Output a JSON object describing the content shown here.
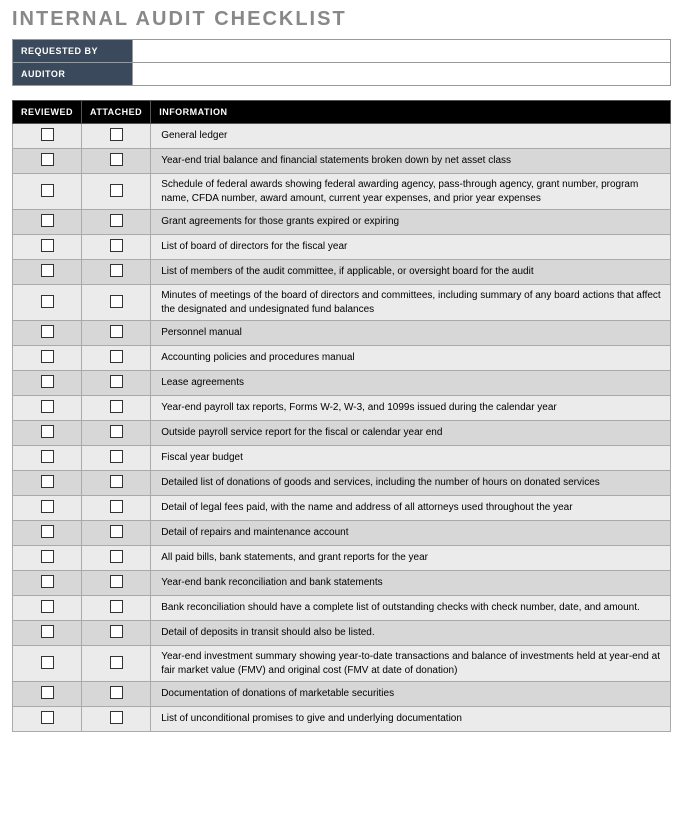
{
  "title": "INTERNAL AUDIT CHECKLIST",
  "header": {
    "requested_by_label": "REQUESTED BY",
    "requested_by_value": "",
    "auditor_label": "AUDITOR",
    "auditor_value": ""
  },
  "columns": {
    "reviewed": "REVIEWED",
    "attached": "ATTACHED",
    "information": "INFORMATION"
  },
  "items": [
    "General ledger",
    "Year-end trial balance and financial statements broken down by net asset class",
    "Schedule of federal awards showing federal awarding agency, pass-through agency, grant number, program name, CFDA number, award amount, current year expenses, and prior year expenses",
    "Grant agreements for those grants expired or expiring",
    "List of board of directors for the fiscal year",
    "List of members of the audit committee, if applicable, or oversight board for the audit",
    "Minutes of meetings of the board of directors and committees, including summary of any board actions that affect the designated and undesignated fund balances",
    "Personnel manual",
    "Accounting policies and procedures manual",
    "Lease agreements",
    "Year-end payroll tax reports, Forms W-2, W-3, and 1099s issued during the calendar year",
    "Outside payroll service report for the fiscal or calendar year end",
    "Fiscal year budget",
    "Detailed list of donations of goods and services, including the number of hours on donated services",
    "Detail of legal fees paid, with the name and address of all attorneys used throughout the year",
    "Detail of repairs and maintenance account",
    "All paid bills, bank statements, and grant reports for the year",
    "Year-end bank reconciliation and bank statements",
    "Bank reconciliation should have a complete list of outstanding checks with check number, date, and amount.",
    "Detail of deposits in transit should also be listed.",
    "Year-end investment summary showing year-to-date transactions and balance of investments held at year-end at fair market value (FMV) and original cost (FMV at date of donation)",
    "Documentation of donations of marketable securities",
    "List of unconditional promises to give and underlying documentation"
  ]
}
